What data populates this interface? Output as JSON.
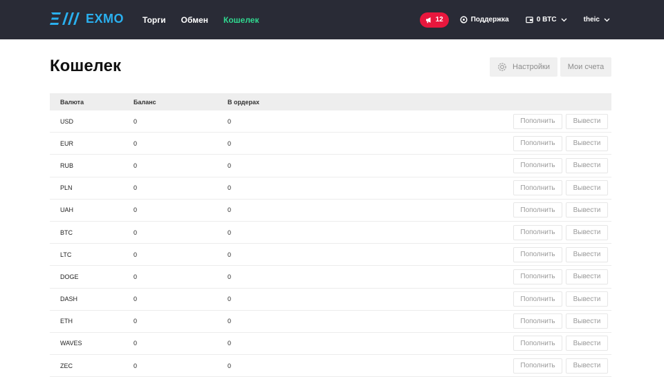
{
  "brand": {
    "logo_text": "EXMO",
    "accent_color": "#2ab0ef"
  },
  "nav": {
    "items": [
      {
        "label": "Торги"
      },
      {
        "label": "Обмен"
      },
      {
        "label": "Кошелек",
        "active": true
      }
    ],
    "active_color": "#30d990"
  },
  "topbar": {
    "notifications_count": "12",
    "support_label": "Поддержка",
    "balance_label": "0 BTC",
    "username": "theic"
  },
  "page": {
    "title": "Кошелек",
    "settings_label": "Настройки",
    "accounts_label": "Мои счета"
  },
  "table": {
    "columns": [
      "Валюта",
      "Баланс",
      "В ордерах"
    ],
    "deposit_label": "Пополнить",
    "withdraw_label": "Вывести",
    "rows": [
      {
        "currency": "USD",
        "balance": "0",
        "in_orders": "0"
      },
      {
        "currency": "EUR",
        "balance": "0",
        "in_orders": "0"
      },
      {
        "currency": "RUB",
        "balance": "0",
        "in_orders": "0"
      },
      {
        "currency": "PLN",
        "balance": "0",
        "in_orders": "0"
      },
      {
        "currency": "UAH",
        "balance": "0",
        "in_orders": "0"
      },
      {
        "currency": "BTC",
        "balance": "0",
        "in_orders": "0"
      },
      {
        "currency": "LTC",
        "balance": "0",
        "in_orders": "0"
      },
      {
        "currency": "DOGE",
        "balance": "0",
        "in_orders": "0"
      },
      {
        "currency": "DASH",
        "balance": "0",
        "in_orders": "0"
      },
      {
        "currency": "ETH",
        "balance": "0",
        "in_orders": "0"
      },
      {
        "currency": "WAVES",
        "balance": "0",
        "in_orders": "0"
      },
      {
        "currency": "ZEC",
        "balance": "0",
        "in_orders": "0"
      }
    ]
  },
  "icons": {
    "logo": "exmo-logo-icon",
    "notification": "megaphone-icon",
    "support": "support-chat-icon",
    "wallet": "wallet-icon",
    "dropdown": "chevron-down-icon",
    "settings": "gear-icon"
  }
}
